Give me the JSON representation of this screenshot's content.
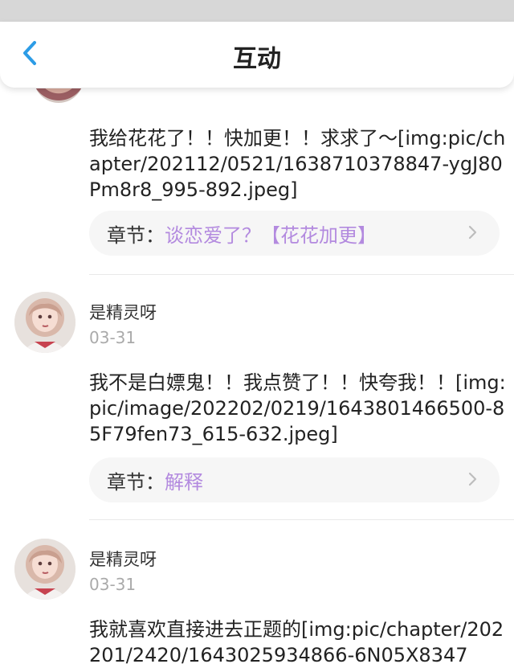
{
  "header": {
    "title": "互动",
    "back_icon": "chevron-left-icon"
  },
  "comments": [
    {
      "content": "我给花花了！！快加更！！求求了～[img:pic/chapter/202112/0521/1638710378847-ygJ80Pm8r8_995-892.jpeg]",
      "chapter_label": "章节：",
      "chapter_link": "谈恋爱了？【花花加更】"
    },
    {
      "username": "是精灵呀",
      "date": "03-31",
      "content": "我不是白嫖鬼！！我点赞了！！快夸我！！[img:pic/image/202202/0219/1643801466500-85F79fen73_615-632.jpeg]",
      "chapter_label": "章节：",
      "chapter_link": "解释"
    },
    {
      "username": "是精灵呀",
      "date": "03-31",
      "content": "我就喜欢直接进去正题的[img:pic/chapter/202201/2420/1643025934866-6N05X8347"
    }
  ],
  "colors": {
    "accent": "#2c9ce6",
    "chapter_link": "#b38adf",
    "muted_text": "#aaaaaa"
  }
}
